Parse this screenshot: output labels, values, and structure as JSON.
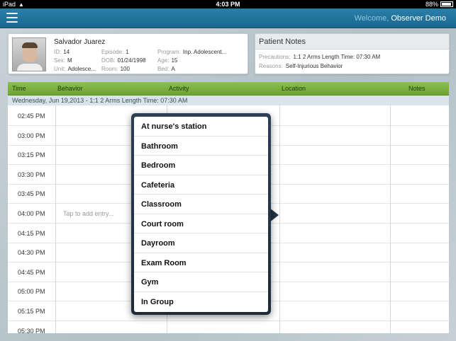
{
  "status_bar": {
    "device": "iPad",
    "time": "4:03 PM",
    "battery": "88%"
  },
  "nav": {
    "welcome_prefix": "Welcome,",
    "user_name": "Observer Demo"
  },
  "patient": {
    "name": "Salvador Juarez",
    "fields": {
      "id_label": "ID:",
      "id": "14",
      "sex_label": "Sex:",
      "sex": "M",
      "unit_label": "Unit:",
      "unit": "Adolesce...",
      "episode_label": "Episode:",
      "episode": "1",
      "dob_label": "DOB:",
      "dob": "01/24/1998",
      "room_label": "Room:",
      "room": "100",
      "program_label": "Program:",
      "program": "Inp. Adolescent...",
      "age_label": "Age:",
      "age": "15",
      "bed_label": "Bed:",
      "bed": "A"
    }
  },
  "notes": {
    "title": "Patient Notes",
    "precautions_label": "Precautions:",
    "precautions": "1:1 2 Arms Length Time: 07:30 AM",
    "reasons_label": "Reasons:",
    "reasons": "Self-Injurious Behavior"
  },
  "table": {
    "headers": {
      "time": "Time",
      "behavior": "Behavior",
      "activity": "Activity",
      "location": "Location",
      "notes": "Notes"
    },
    "date_row": "Wednesday, Jun 19,2013 - 1:1 2 Arms Length Time: 07:30 AM",
    "rows": [
      "02:45 PM",
      "03:00 PM",
      "03:15 PM",
      "03:30 PM",
      "03:45 PM",
      "04:00 PM",
      "04:15 PM",
      "04:30 PM",
      "04:45 PM",
      "05:00 PM",
      "05:15 PM",
      "05:30 PM"
    ],
    "entry_placeholder": "Tap to add entry..."
  },
  "location_picker": {
    "options": [
      "At nurse's station",
      "Bathroom",
      "Bedroom",
      "Cafeteria",
      "Classroom",
      "Court room",
      "Dayroom",
      "Exam Room",
      "Gym",
      "In Group"
    ]
  },
  "colors": {
    "nav_blue": "#1f7099",
    "header_green": "#7ab53f",
    "popover_navy": "#243347"
  }
}
